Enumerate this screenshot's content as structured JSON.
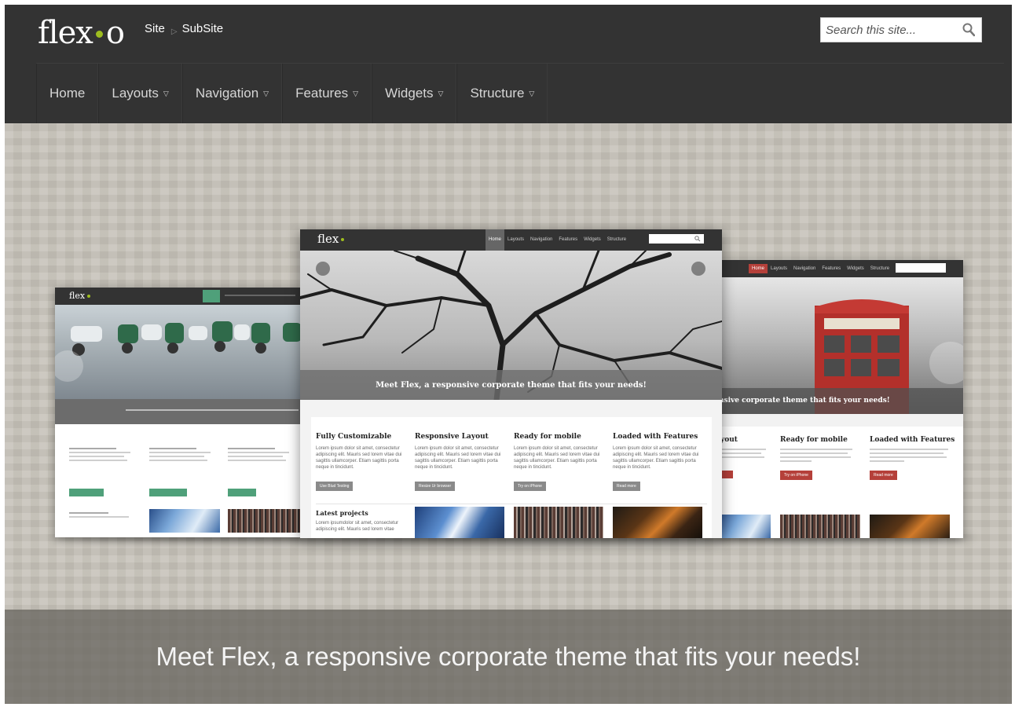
{
  "header": {
    "logo_left": "flex",
    "logo_right": "o",
    "breadcrumb": {
      "site": "Site",
      "subsite": "SubSite"
    },
    "search": {
      "placeholder": "Search this site..."
    }
  },
  "nav": {
    "items": [
      {
        "label": "Home",
        "has_caret": false
      },
      {
        "label": "Layouts",
        "has_caret": true
      },
      {
        "label": "Navigation",
        "has_caret": true
      },
      {
        "label": "Features",
        "has_caret": true
      },
      {
        "label": "Widgets",
        "has_caret": true
      },
      {
        "label": "Structure",
        "has_caret": true
      }
    ]
  },
  "hero": {
    "caption": "Meet Flex, a responsive corporate theme that fits your needs!"
  },
  "mockups": {
    "center": {
      "logo": "flex",
      "nav": [
        "Home",
        "Layouts",
        "Navigation",
        "Features",
        "Widgets",
        "Structure"
      ],
      "slide_caption": "Meet Flex, a responsive corporate theme that fits your needs!",
      "columns": [
        {
          "title": "Fully Customizable",
          "text": "Lorem ipsum dolor sit amet, consectetur adipiscing elit. Mauris sed lorem vitae dui sagittis ullamcorper. Etiam sagittis porta neque in tincidunt.",
          "button": "Use Blud Testing"
        },
        {
          "title": "Responsive Layout",
          "text": "Lorem ipsum dolor sit amet, consectetur adipiscing elit. Mauris sed lorem vitae dui sagittis ullamcorper. Etiam sagittis porta neque in tincidunt.",
          "button": "Resize Ur browser"
        },
        {
          "title": "Ready for mobile",
          "text": "Lorem ipsum dolor sit amet, consectetur adipiscing elit. Mauris sed lorem vitae dui sagittis ullamcorper. Etiam sagittis porta neque in tincidunt.",
          "button": "Try on iPhone"
        },
        {
          "title": "Loaded with Features",
          "text": "Lorem ipsum dolor sit amet, consectetur adipiscing elit. Mauris sed lorem vitae dui sagittis ullamcorper. Etiam sagittis porta neque in tincidunt.",
          "button": "Read more"
        }
      ],
      "latest_title": "Latest projects",
      "latest_text": "Lorem ipsumdolor sit amet, consectetur adipiscing elit. Mauris sed lorem vitae"
    },
    "right": {
      "nav": [
        "Home",
        "Layouts",
        "Navigation",
        "Features",
        "Widgets",
        "Structure"
      ],
      "slide_caption": "nsive corporate theme that fits your needs!",
      "columns": [
        {
          "title": "yout",
          "button": ""
        },
        {
          "title": "Ready for mobile",
          "button": "Try on iPhone"
        },
        {
          "title": "Loaded with Features",
          "button": "Read more"
        }
      ]
    },
    "left": {
      "logo": "flex"
    }
  },
  "colors": {
    "header_bg": "#333333",
    "accent_green": "#9ebd1f",
    "hero_bg": "#c7c3ba",
    "caption_bg": "#696660",
    "left_accent": "#4fa07a",
    "right_accent": "#b5403a",
    "center_button": "#8a8a8a"
  }
}
